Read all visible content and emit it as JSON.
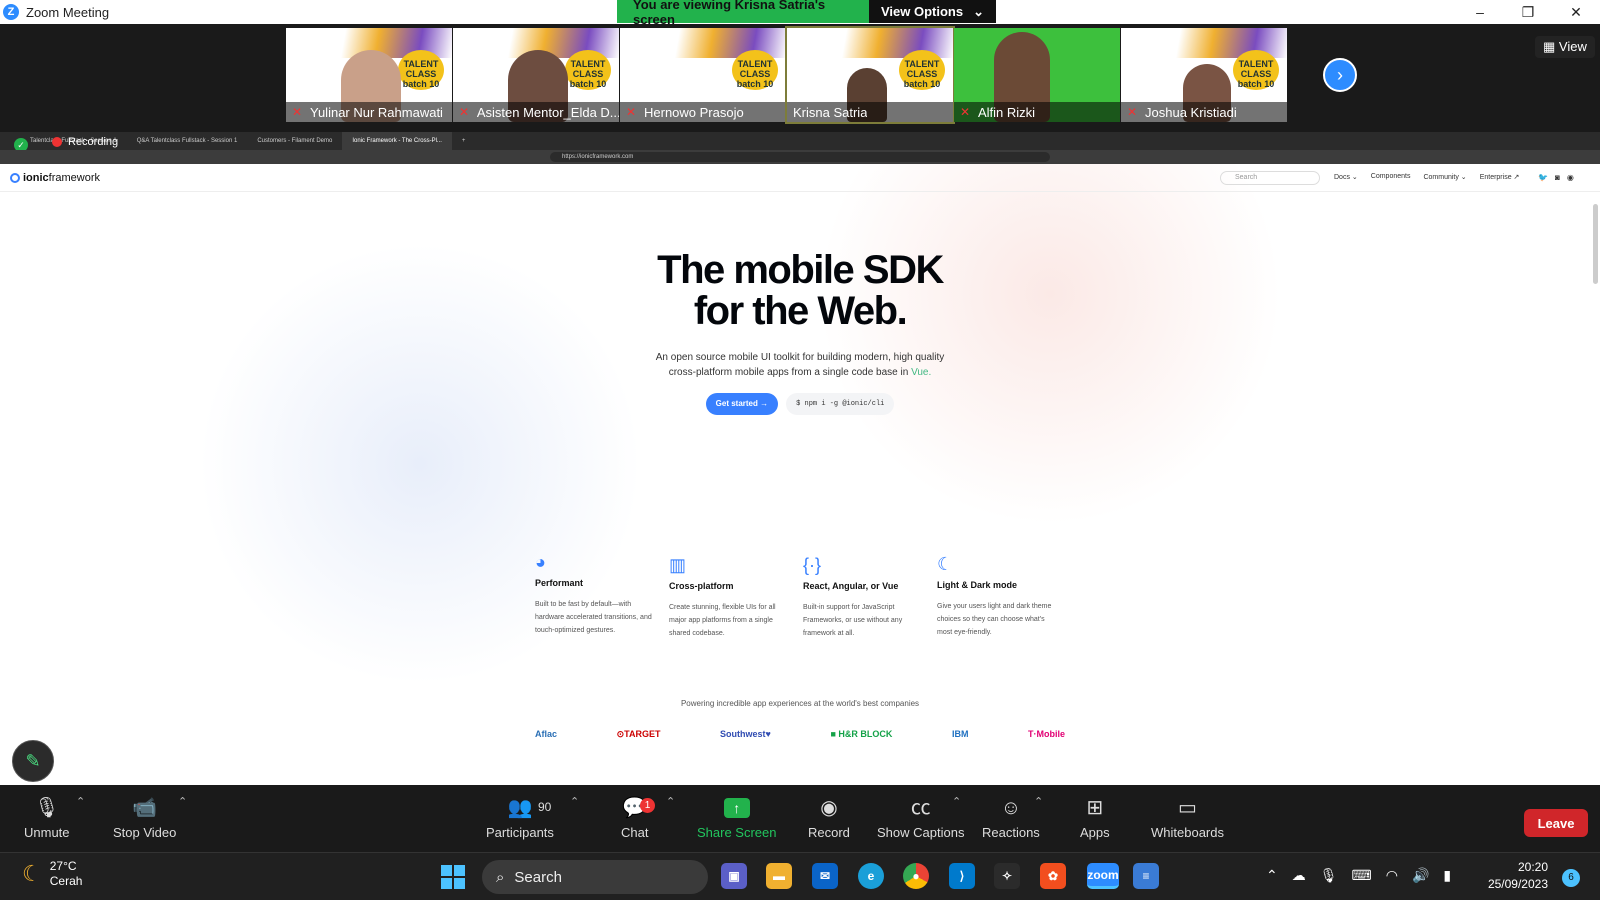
{
  "window": {
    "app_title": "Zoom Meeting",
    "minimize": "–",
    "restore": "❐",
    "close": "✕"
  },
  "banner": {
    "viewing_text": "You are viewing Krisna Satria's screen",
    "view_options_label": "View Options",
    "caret": "⌄"
  },
  "gallery": {
    "participants": [
      {
        "name": "Yulinar Nur Rahmawati"
      },
      {
        "name": "Asisten Mentor_Elda D..."
      },
      {
        "name": "Hernowo Prasojo"
      },
      {
        "name": "Krisna Satria"
      },
      {
        "name": "Alfin Rizki"
      },
      {
        "name": "Joshua Kristiadi"
      }
    ],
    "badge_text": "TALENT CLASS batch 10",
    "next_icon": "›",
    "view_label": "View"
  },
  "shared_screen": {
    "recording_label": "Recording",
    "browser_tabs": [
      "Talentclass Fullstack - Session 1",
      "Q&A Talentclass Fullstack - Session 1",
      "Customers - Filament Demo",
      "Ionic Framework - The Cross-Pl...",
      "+"
    ],
    "url": "https://ionicframework.com",
    "site": {
      "logo_bold": "ionic",
      "logo_rest": "framework",
      "search_placeholder": "Search",
      "nav": [
        "Docs ⌄",
        "Components",
        "Community ⌄",
        "Enterprise ↗"
      ],
      "hero_line1": "The mobile SDK",
      "hero_line2": "for the Web.",
      "subtitle_line1": "An open source mobile UI toolkit for building modern, high quality",
      "subtitle_line2": "cross-platform mobile apps from a single code base in ",
      "subtitle_highlight": "Vue.",
      "get_started": "Get started →",
      "npm_command": "$ npm i -g @ionic/cli",
      "features": [
        {
          "icon": "◕",
          "title": "Performant",
          "desc": "Built to be fast by default—with hardware accelerated transitions, and touch-optimized gestures."
        },
        {
          "icon": "▥",
          "title": "Cross-platform",
          "desc": "Create stunning, flexible UIs for all major app platforms from a single shared codebase."
        },
        {
          "icon": "{·}",
          "title": "React, Angular, or Vue",
          "desc": "Built-in support for JavaScript Frameworks, or use without any framework at all."
        },
        {
          "icon": "☾",
          "title": "Light & Dark mode",
          "desc": "Give your users light and dark theme choices so they can choose what's most eye-friendly."
        }
      ],
      "powering_text": "Powering incredible app experiences at the world's best companies",
      "companies": [
        {
          "name": "Aflac",
          "color": "#2a6fb5"
        },
        {
          "name": "⊙TARGET",
          "color": "#cc0000"
        },
        {
          "name": "Southwest♥",
          "color": "#304cb2"
        },
        {
          "name": "■ H&R BLOCK",
          "color": "#14a248"
        },
        {
          "name": "IBM",
          "color": "#1f70c1"
        },
        {
          "name": "T·Mobile",
          "color": "#e20074"
        }
      ]
    }
  },
  "toolbar": {
    "unmute": "Unmute",
    "stop_video": "Stop Video",
    "participants": "Participants",
    "participant_count": "90",
    "chat": "Chat",
    "chat_badge": "1",
    "share_screen": "Share Screen",
    "record": "Record",
    "show_captions": "Show Captions",
    "reactions": "Reactions",
    "apps": "Apps",
    "whiteboards": "Whiteboards",
    "leave": "Leave"
  },
  "taskbar": {
    "temperature": "27°C",
    "weather": "Cerah",
    "search_label": "Search",
    "time": "20:20",
    "date": "25/09/2023",
    "notification_count": "6"
  }
}
